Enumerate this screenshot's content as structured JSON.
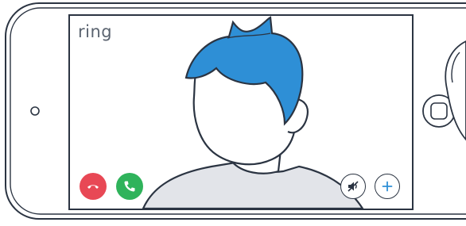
{
  "app": {
    "brand_text": "ring"
  },
  "call": {
    "controls": {
      "decline_icon": "phone-hangup-icon",
      "accept_icon": "phone-icon",
      "mute_icon": "speaker-muted-icon",
      "add_icon": "plus-icon"
    }
  },
  "colors": {
    "hair": "#2e8fd6",
    "shirt": "#e2e4e9",
    "ink": "#2b3442",
    "decline": "#e84855",
    "accept": "#2fb35b",
    "add": "#2e8fd6"
  }
}
